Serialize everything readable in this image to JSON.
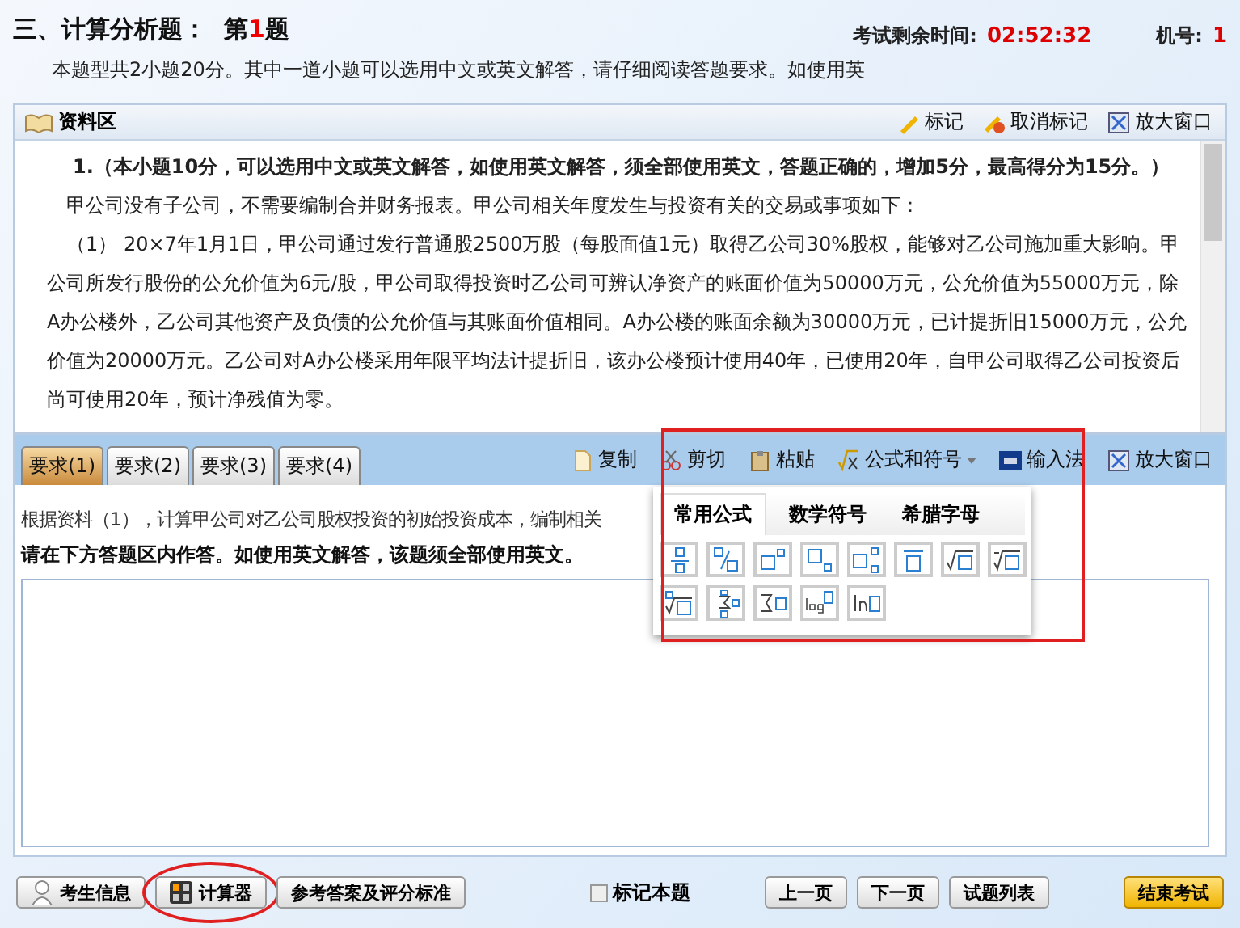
{
  "header": {
    "section": "三、计算分析题：",
    "question_prefix": "第",
    "question_number": "1",
    "question_suffix": "题",
    "timer_label": "考试剩余时间:",
    "timer_value": "02:52:32",
    "seat_label": "机号:",
    "seat_value": "1",
    "intro": "本题型共2小题20分。其中一道小题可以选用中文或英文解答，请仔细阅读答题要求。如使用英"
  },
  "material": {
    "title": "资料区",
    "actions": [
      {
        "kind": "mark",
        "label": "标记"
      },
      {
        "kind": "unmark",
        "label": "取消标记"
      },
      {
        "kind": "maximize",
        "label": "放大窗口"
      }
    ],
    "heading": "1.（本小题10分，可以选用中文或英文解答，如使用英文解答，须全部使用英文，答题正确的，增加5分，最高得分为15分。）",
    "paragraphs": [
      "甲公司没有子公司，不需要编制合并财务报表。甲公司相关年度发生与投资有关的交易或事项如下：",
      "（1） 20×7年1月1日，甲公司通过发行普通股2500万股（每股面值1元）取得乙公司30%股权，能够对乙公司施加重大影响。甲公司所发行股份的公允价值为6元/股，甲公司取得投资时乙公司可辨认净资产的账面价值为50000万元，公允价值为55000万元，除A办公楼外，乙公司其他资产及负债的公允价值与其账面价值相同。A办公楼的账面余额为30000万元，已计提折旧15000万元，公允价值为20000万元。乙公司对A办公楼采用年限平均法计提折旧，该办公楼预计使用40年，已使用20年，自甲公司取得乙公司投资后尚可使用20年，预计净残值为零。"
    ]
  },
  "requirements": {
    "tabs": [
      {
        "label": "要求(1)",
        "selected": true
      },
      {
        "label": "要求(2)",
        "selected": false
      },
      {
        "label": "要求(3)",
        "selected": false
      },
      {
        "label": "要求(4)",
        "selected": false
      }
    ],
    "tools": [
      {
        "kind": "copy",
        "label": "复制"
      },
      {
        "kind": "cut",
        "label": "剪切"
      },
      {
        "kind": "paste",
        "label": "粘贴"
      },
      {
        "kind": "formula",
        "label": "公式和符号"
      },
      {
        "kind": "ime",
        "label": "输入法"
      },
      {
        "kind": "maximize",
        "label": "放大窗口"
      }
    ],
    "prompt": "根据资料（1），计算甲公司对乙公司股权投资的初始投资成本，编制相关",
    "instruction": "请在下方答题区内作答。如使用英文解答，该题须全部使用英文。"
  },
  "formula_popup": {
    "tabs": [
      {
        "label": "常用公式",
        "selected": true
      },
      {
        "label": "数学符号",
        "selected": false
      },
      {
        "label": "希腊字母",
        "selected": false
      }
    ],
    "buttons": [
      {
        "kind": "fraction"
      },
      {
        "kind": "slash"
      },
      {
        "kind": "sup"
      },
      {
        "kind": "sub"
      },
      {
        "kind": "supsub"
      },
      {
        "kind": "overline"
      },
      {
        "kind": "sqrt"
      },
      {
        "kind": "cuberoot"
      },
      {
        "kind": "nroot"
      },
      {
        "kind": "sumlimits"
      },
      {
        "kind": "sum"
      },
      {
        "kind": "log"
      },
      {
        "kind": "ln"
      }
    ]
  },
  "footer": {
    "left": [
      {
        "kind": "user",
        "label": "考生信息",
        "circled": false
      },
      {
        "kind": "calc",
        "label": "计算器",
        "circled": true
      },
      {
        "kind": "plain",
        "label": "参考答案及评分标准",
        "circled": false
      }
    ],
    "mark": {
      "label": "标记本题",
      "checked": false
    },
    "nav": [
      {
        "label": "上一页"
      },
      {
        "label": "下一页"
      },
      {
        "label": "试题列表"
      }
    ],
    "end": "结束考试"
  }
}
